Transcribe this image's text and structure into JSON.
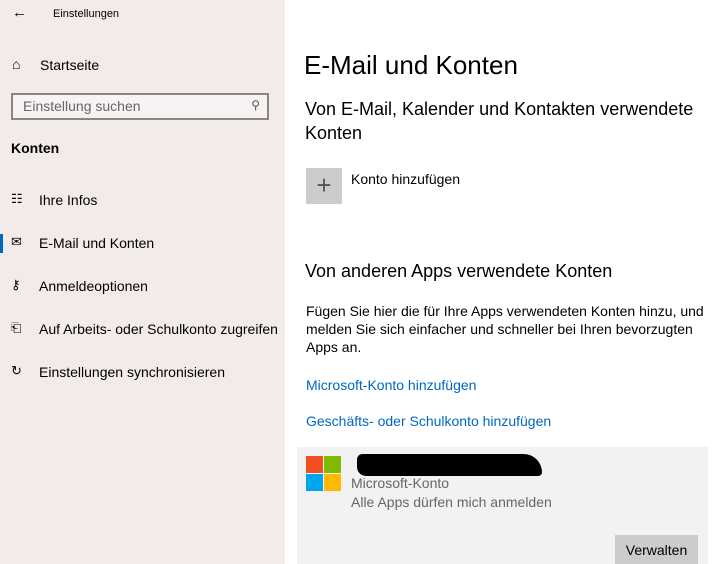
{
  "window": {
    "title": "Einstellungen"
  },
  "sidebar": {
    "home": "Startseite",
    "search_placeholder": "Einstellung suchen",
    "section": "Konten",
    "items": [
      {
        "label": "Ihre Infos",
        "icon": "person-card-icon",
        "glyph": "☷"
      },
      {
        "label": "E-Mail und Konten",
        "icon": "mail-icon",
        "glyph": "✉"
      },
      {
        "label": "Anmeldeoptionen",
        "icon": "key-icon",
        "glyph": "⚷"
      },
      {
        "label": "Auf Arbeits- oder Schulkonto zugreifen",
        "icon": "briefcase-icon",
        "glyph": "⎗"
      },
      {
        "label": "Einstellungen synchronisieren",
        "icon": "sync-icon",
        "glyph": "↻"
      }
    ]
  },
  "main": {
    "title": "E-Mail und Konten",
    "section1": "Von E-Mail, Kalender und Kontakten verwendete Konten",
    "add_account": "Konto hinzufügen",
    "section2": "Von anderen Apps verwendete Konten",
    "description": "Fügen Sie hier die für Ihre Apps verwendeten Konten hinzu, und melden Sie sich einfacher und schneller bei Ihren bevorzugten Apps an.",
    "link_ms": "Microsoft-Konto hinzufügen",
    "link_work": "Geschäfts- oder Schulkonto hinzufügen",
    "account": {
      "type": "Microsoft-Konto",
      "status": "Alle Apps dürfen mich anmelden",
      "manage": "Verwalten"
    }
  },
  "colors": {
    "accent": "#0067c0",
    "logo": [
      "#f25022",
      "#7fba00",
      "#00a4ef",
      "#ffb900"
    ]
  }
}
